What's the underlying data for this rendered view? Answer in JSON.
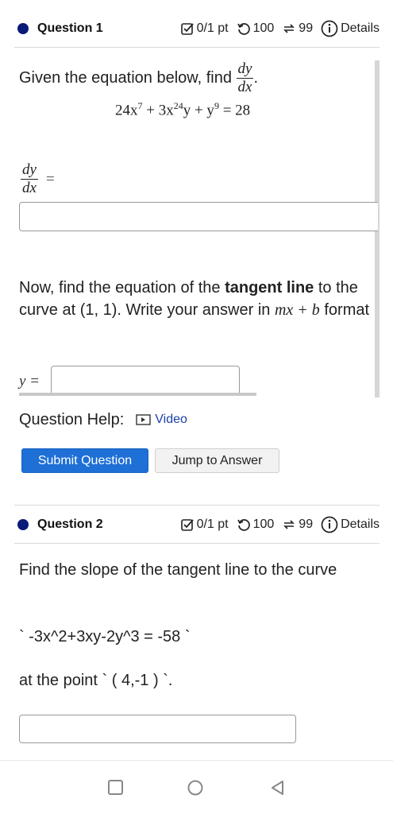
{
  "question1": {
    "title": "Question 1",
    "points": "0/1 pt",
    "retries": "100",
    "attempts": "99",
    "details": "Details",
    "prompt_text": "Given the equation below, find",
    "frac_num": "dy",
    "frac_den": "dx",
    "equation_parts": {
      "c1": "24x",
      "e1": "7",
      "c2": " + 3x",
      "e2": "24",
      "c3": "y + y",
      "e3": "9",
      "c4": " = 28"
    },
    "dydx_eq": "=",
    "tangent_pre": "Now, find the equation of the",
    "tangent_bold": "tangent line",
    "tangent_post": "to the curve at (1, 1). Write your answer in",
    "format_math": "mx + b",
    "format_text": "format",
    "y_label": "y =",
    "help_label": "Question Help:",
    "video_label": "Video",
    "submit_label": "Submit Question",
    "jump_label": "Jump to Answer"
  },
  "question2": {
    "title": "Question 2",
    "points": "0/1 pt",
    "retries": "100",
    "attempts": "99",
    "details": "Details",
    "line1": "Find the slope of the tangent line to the curve",
    "equation": "` -3x^2+3xy-2y^3 = -58 `",
    "point": "at the point ` ( 4,-1 ) `."
  },
  "colors": {
    "dot": "#0a1a7a",
    "primary_button": "#1e6fd6",
    "link": "#1a3fa8"
  },
  "icons": [
    "checkbox-icon",
    "retry-icon",
    "attempts-icon",
    "info-icon",
    "video-icon",
    "square-nav-icon",
    "circle-nav-icon",
    "back-nav-icon"
  ]
}
